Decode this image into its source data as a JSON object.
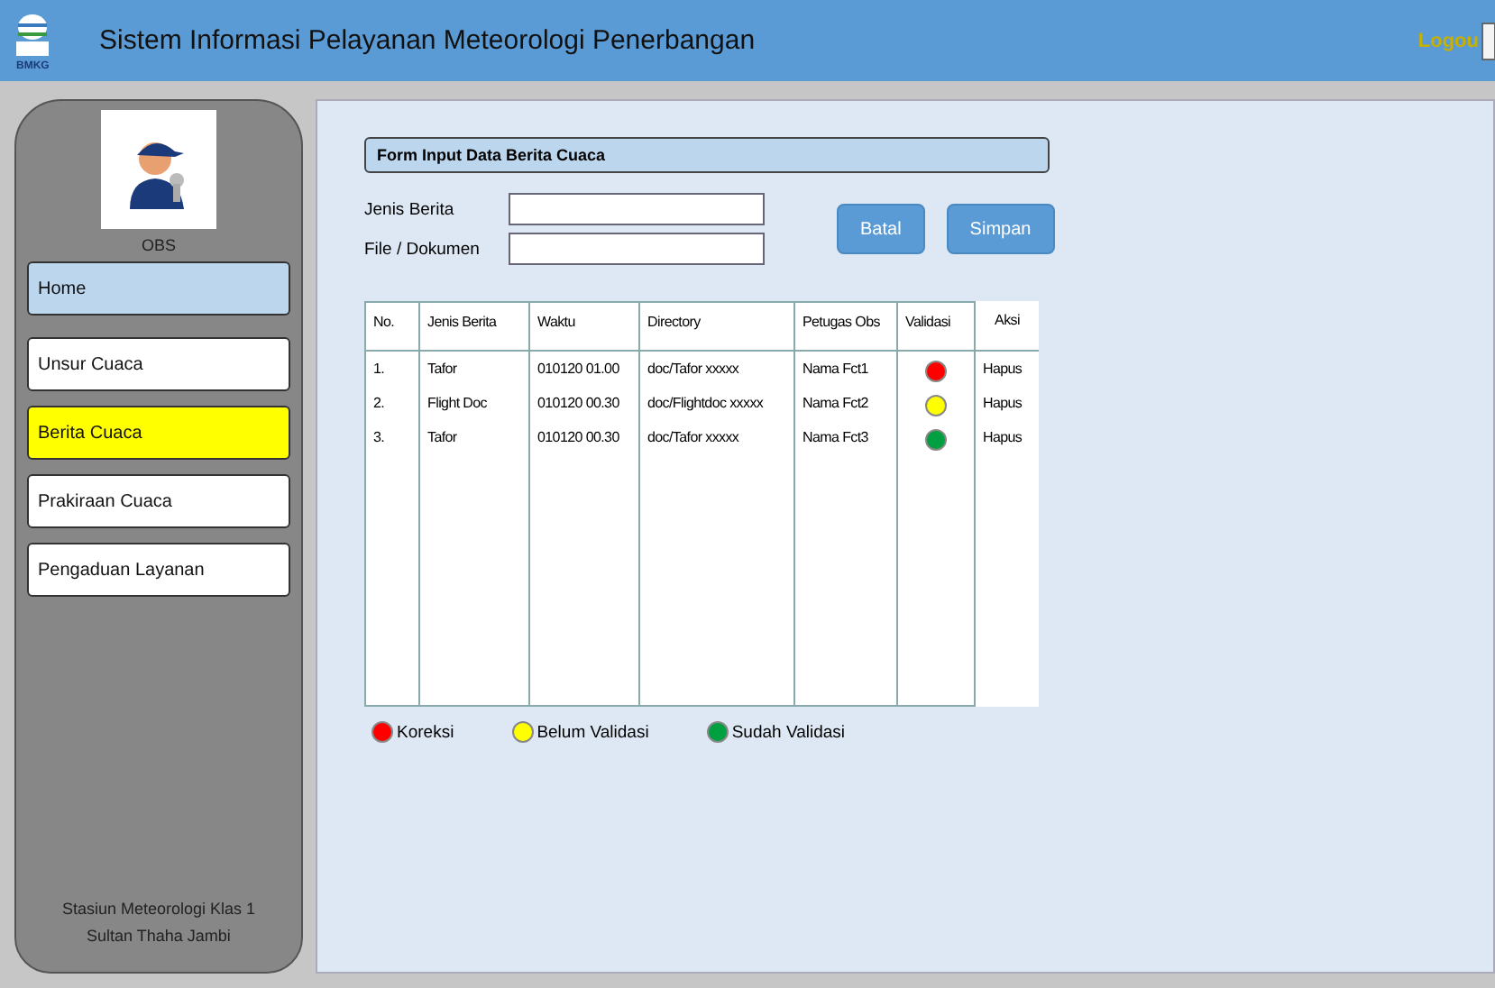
{
  "header": {
    "logo_caption": "BMKG",
    "title": "Sistem Informasi Pelayanan Meteorologi Penerbangan",
    "logout": "Logou"
  },
  "sidebar": {
    "user_label": "OBS",
    "items": [
      {
        "label": "Home",
        "kind": "home",
        "selected": false
      },
      {
        "label": "Unsur Cuaca",
        "kind": "menu",
        "selected": false
      },
      {
        "label": "Berita Cuaca",
        "kind": "menu",
        "selected": true
      },
      {
        "label": "Prakiraan Cuaca",
        "kind": "menu",
        "selected": false
      },
      {
        "label": "Pengaduan Layanan",
        "kind": "menu",
        "selected": false
      }
    ],
    "footer": [
      "Stasiun Meteorologi Klas 1",
      "Sultan Thaha Jambi"
    ]
  },
  "form": {
    "title": "Form Input Data Berita Cuaca",
    "fields": [
      {
        "label": "Jenis Berita"
      },
      {
        "label": "File / Dokumen"
      }
    ],
    "buttons": [
      "Batal",
      "Simpan"
    ]
  },
  "table": {
    "columns": [
      "No.",
      "Jenis Berita",
      "Waktu",
      "Directory",
      "Petugas Obs",
      "Validasi",
      "Aksi"
    ],
    "rows": [
      {
        "no": "1.",
        "jenis": "Tafor",
        "waktu": "010120 01.00",
        "directory": "doc/Tafor xxxxx",
        "petugas": "Nama Fct1",
        "color": "#ff0000",
        "aksi": "Hapus"
      },
      {
        "no": "2.",
        "jenis": "Flight Doc",
        "waktu": "010120 00.30",
        "directory": "doc/Flightdoc xxxxx",
        "petugas": "Nama Fct2",
        "color": "#ffff00",
        "aksi": "Hapus"
      },
      {
        "no": "3.",
        "jenis": "Tafor",
        "waktu": "010120 00.30",
        "directory": "doc/Tafor xxxxx",
        "petugas": "Nama Fct3",
        "color": "#00a040",
        "aksi": "Hapus"
      }
    ]
  },
  "legend": [
    {
      "label": "Koreksi",
      "color": "#ff0000"
    },
    {
      "label": "Belum Validasi",
      "color": "#ffff00"
    },
    {
      "label": "Sudah Validasi",
      "color": "#00a040"
    }
  ]
}
